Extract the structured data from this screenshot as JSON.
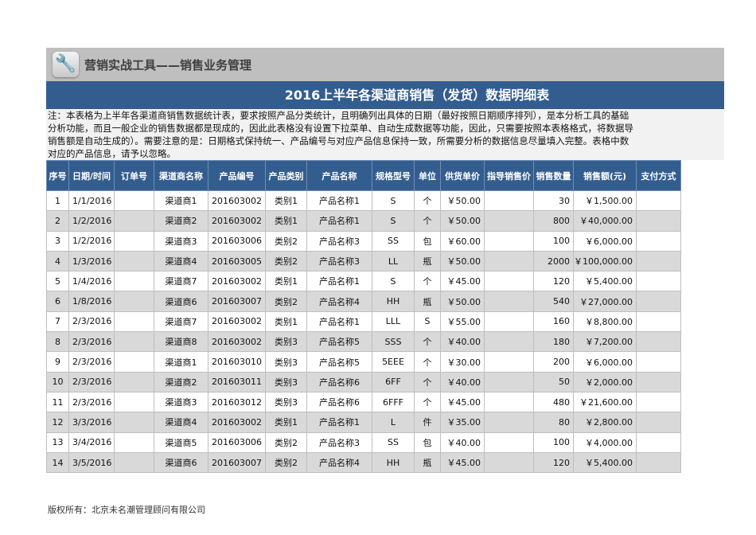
{
  "header": {
    "app_title": "营销实战工具——销售业务管理",
    "sheet_title": "2016上半年各渠道商销售（发货）数据明细表"
  },
  "note": [
    "注：本表格为上半年各渠道商销售数据统计表，要求按照产品分类统计，且明确列出具体的日期（最好按照日期顺序排列），是本分析工具的基础",
    "分析功能，而且一般企业的销售数据都是现成的，因此此表格没有设置下拉菜单、自动生成数据等功能，因此，只需要按照本表格格式，将数据导",
    "销售额是自动生成的）。需要注意的是：日期格式保持统一、产品编号与对应产品信息保持一致，所需要分析的数据信息尽量填入完整。表格中数",
    "对应的产品信息，请予以忽略。"
  ],
  "table": {
    "columns": [
      "序号",
      "日期/时间",
      "订单号",
      "渠道商名称",
      "产品编号",
      "产品类别",
      "产品名称",
      "规格型号",
      "单位",
      "供货单价",
      "指导销售价",
      "销售数量",
      "销售额(元)",
      "支付方式"
    ],
    "rows": [
      [
        "1",
        "1/1/2016",
        "",
        "渠道商1",
        "201603002",
        "类别1",
        "产品名称1",
        "S",
        "个",
        "￥50.00",
        "",
        "30",
        "￥1,500.00",
        ""
      ],
      [
        "2",
        "1/2/2016",
        "",
        "渠道商2",
        "201603002",
        "类别1",
        "产品名称1",
        "S",
        "个",
        "￥50.00",
        "",
        "800",
        "￥40,000.00",
        ""
      ],
      [
        "3",
        "1/2/2016",
        "",
        "渠道商3",
        "201603006",
        "类别2",
        "产品名称3",
        "SS",
        "包",
        "￥60.00",
        "",
        "100",
        "￥6,000.00",
        ""
      ],
      [
        "4",
        "1/3/2016",
        "",
        "渠道商4",
        "201603005",
        "类别2",
        "产品名称3",
        "LL",
        "瓶",
        "￥50.00",
        "",
        "2000",
        "￥100,000.00",
        ""
      ],
      [
        "5",
        "1/4/2016",
        "",
        "渠道商7",
        "201603002",
        "类别1",
        "产品名称1",
        "S",
        "个",
        "￥45.00",
        "",
        "120",
        "￥5,400.00",
        ""
      ],
      [
        "6",
        "1/8/2016",
        "",
        "渠道商6",
        "201603007",
        "类别2",
        "产品名称4",
        "HH",
        "瓶",
        "￥50.00",
        "",
        "540",
        "￥27,000.00",
        ""
      ],
      [
        "7",
        "2/3/2016",
        "",
        "渠道商7",
        "201603002",
        "类别1",
        "产品名称1",
        "LLL",
        "S",
        "￥55.00",
        "",
        "160",
        "￥8,800.00",
        ""
      ],
      [
        "8",
        "2/3/2016",
        "",
        "渠道商8",
        "201603002",
        "类别3",
        "产品名称5",
        "SSS",
        "个",
        "￥40.00",
        "",
        "180",
        "￥7,200.00",
        ""
      ],
      [
        "9",
        "2/3/2016",
        "",
        "渠道商1",
        "201603010",
        "类别3",
        "产品名称5",
        "5EEE",
        "个",
        "￥30.00",
        "",
        "200",
        "￥6,000.00",
        ""
      ],
      [
        "10",
        "2/3/2016",
        "",
        "渠道商2",
        "201603011",
        "类别3",
        "产品名称6",
        "6FF",
        "个",
        "￥40.00",
        "",
        "50",
        "￥2,000.00",
        ""
      ],
      [
        "11",
        "2/3/2016",
        "",
        "渠道商3",
        "201603012",
        "类别3",
        "产品名称6",
        "6FFF",
        "个",
        "￥45.00",
        "",
        "480",
        "￥21,600.00",
        ""
      ],
      [
        "12",
        "3/3/2016",
        "",
        "渠道商4",
        "201603002",
        "类别1",
        "产品名称1",
        "L",
        "件",
        "￥35.00",
        "",
        "80",
        "￥2,800.00",
        ""
      ],
      [
        "13",
        "3/4/2016",
        "",
        "渠道商5",
        "201603006",
        "类别2",
        "产品名称3",
        "SS",
        "包",
        "￥40.00",
        "",
        "100",
        "￥4,000.00",
        ""
      ],
      [
        "14",
        "3/5/2016",
        "",
        "渠道商6",
        "201603007",
        "类别2",
        "产品名称4",
        "HH",
        "瓶",
        "￥45.00",
        "",
        "120",
        "￥5,400.00",
        ""
      ]
    ]
  },
  "footer": {
    "copyright": "版权所有：北京未名潮管理顾问有限公司"
  }
}
